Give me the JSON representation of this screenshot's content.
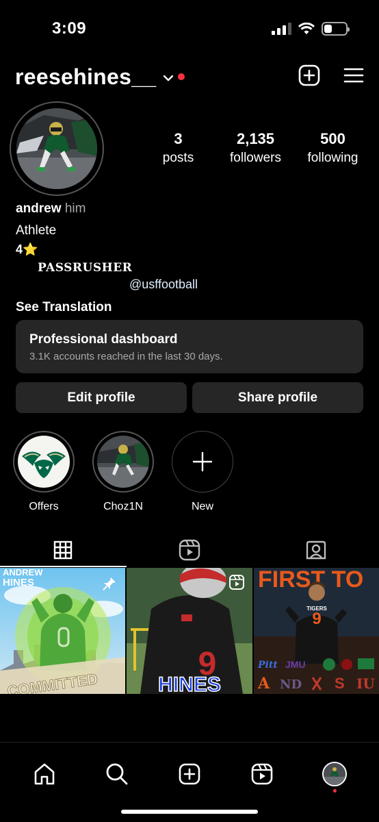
{
  "status_bar": {
    "time": "3:09",
    "battery_level": 0.35
  },
  "header": {
    "username": "reesehines__"
  },
  "profile": {
    "stats": [
      {
        "value": "3",
        "label": "posts"
      },
      {
        "value": "2,135",
        "label": "followers"
      },
      {
        "value": "500",
        "label": "following"
      }
    ],
    "bio": {
      "name": "andrew",
      "pronouns": "him",
      "category": "Athlete",
      "stars": "4⭐️",
      "headline": "PASSRUSHER",
      "mention": "@usffootball",
      "translate": "See Translation"
    }
  },
  "dashboard": {
    "title": "Professional dashboard",
    "subtitle": "3.1K accounts reached in the last 30 days."
  },
  "buttons": {
    "edit": "Edit profile",
    "share": "Share profile"
  },
  "highlights": [
    {
      "label": "Offers"
    },
    {
      "label": "Choz1N"
    },
    {
      "label": "New"
    }
  ],
  "posts": [
    {
      "title": "ANDREW",
      "subtitle": "HINES",
      "caption": "COMMITTED",
      "jersey": "0"
    },
    {
      "caption": "HINES",
      "jersey": "9"
    },
    {
      "title": "FIRST TO",
      "jersey": "9",
      "team": "TIGERS",
      "logos": [
        "Pitt",
        "JMU",
        "A",
        "ND",
        "S",
        "IU"
      ]
    }
  ],
  "colors": {
    "accent_red": "#ff3040",
    "usf_green": "#006747",
    "card_bg": "#262626"
  }
}
